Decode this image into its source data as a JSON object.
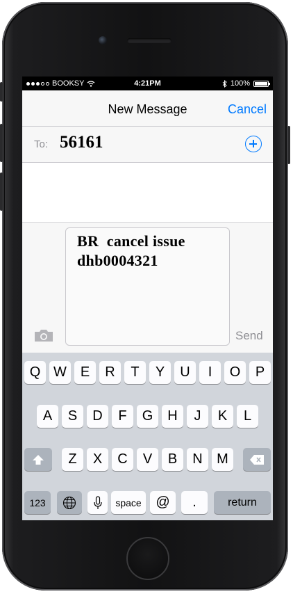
{
  "status_bar": {
    "carrier": "BOOKSY",
    "time": "4:21PM",
    "battery": "100%",
    "battery_level": 1.0
  },
  "nav": {
    "title": "New Message",
    "cancel": "Cancel"
  },
  "recipient": {
    "label": "To:",
    "value": "56161"
  },
  "compose": {
    "message": "BR  cancel issue\ndhb0004321",
    "send": "Send"
  },
  "keyboard": {
    "row1": [
      "Q",
      "W",
      "E",
      "R",
      "T",
      "Y",
      "U",
      "I",
      "O",
      "P"
    ],
    "row2": [
      "A",
      "S",
      "D",
      "F",
      "G",
      "H",
      "J",
      "K",
      "L"
    ],
    "row3": [
      "Z",
      "X",
      "C",
      "V",
      "B",
      "N",
      "M"
    ],
    "bottom": {
      "numbers": "123",
      "space": "space",
      "at": "@",
      "period": ".",
      "return": "return"
    }
  },
  "icons": {
    "wifi": "wifi-icon",
    "bluetooth": "bluetooth-icon",
    "battery": "battery-icon",
    "add_contact": "plus-circle-icon",
    "camera": "camera-icon",
    "shift": "shift-icon",
    "globe": "globe-icon",
    "microphone": "microphone-icon",
    "delete": "delete-icon"
  },
  "colors": {
    "accent": "#007aff",
    "send_disabled": "#8e8e93",
    "keyboard_bg": "#d1d5db"
  }
}
